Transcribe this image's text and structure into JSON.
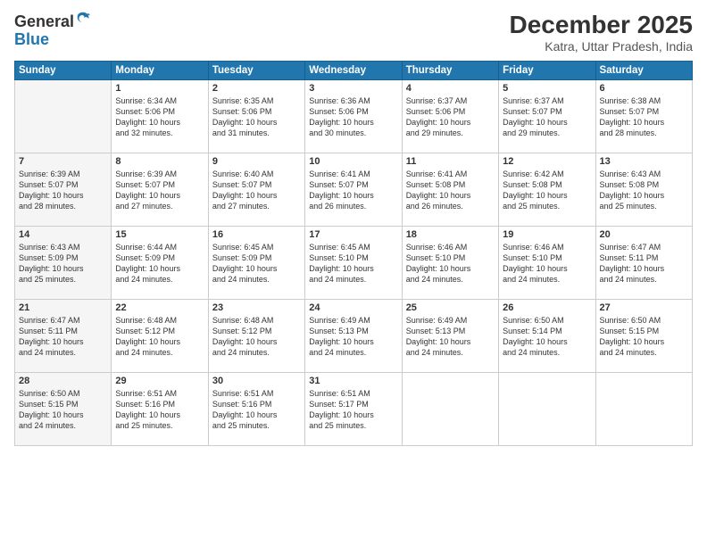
{
  "header": {
    "logo_general": "General",
    "logo_blue": "Blue",
    "month_title": "December 2025",
    "subtitle": "Katra, Uttar Pradesh, India"
  },
  "calendar": {
    "headers": [
      "Sunday",
      "Monday",
      "Tuesday",
      "Wednesday",
      "Thursday",
      "Friday",
      "Saturday"
    ],
    "weeks": [
      [
        {
          "day": "",
          "info": ""
        },
        {
          "day": "1",
          "info": "Sunrise: 6:34 AM\nSunset: 5:06 PM\nDaylight: 10 hours\nand 32 minutes."
        },
        {
          "day": "2",
          "info": "Sunrise: 6:35 AM\nSunset: 5:06 PM\nDaylight: 10 hours\nand 31 minutes."
        },
        {
          "day": "3",
          "info": "Sunrise: 6:36 AM\nSunset: 5:06 PM\nDaylight: 10 hours\nand 30 minutes."
        },
        {
          "day": "4",
          "info": "Sunrise: 6:37 AM\nSunset: 5:06 PM\nDaylight: 10 hours\nand 29 minutes."
        },
        {
          "day": "5",
          "info": "Sunrise: 6:37 AM\nSunset: 5:07 PM\nDaylight: 10 hours\nand 29 minutes."
        },
        {
          "day": "6",
          "info": "Sunrise: 6:38 AM\nSunset: 5:07 PM\nDaylight: 10 hours\nand 28 minutes."
        }
      ],
      [
        {
          "day": "7",
          "info": "Sunrise: 6:39 AM\nSunset: 5:07 PM\nDaylight: 10 hours\nand 28 minutes."
        },
        {
          "day": "8",
          "info": "Sunrise: 6:39 AM\nSunset: 5:07 PM\nDaylight: 10 hours\nand 27 minutes."
        },
        {
          "day": "9",
          "info": "Sunrise: 6:40 AM\nSunset: 5:07 PM\nDaylight: 10 hours\nand 27 minutes."
        },
        {
          "day": "10",
          "info": "Sunrise: 6:41 AM\nSunset: 5:07 PM\nDaylight: 10 hours\nand 26 minutes."
        },
        {
          "day": "11",
          "info": "Sunrise: 6:41 AM\nSunset: 5:08 PM\nDaylight: 10 hours\nand 26 minutes."
        },
        {
          "day": "12",
          "info": "Sunrise: 6:42 AM\nSunset: 5:08 PM\nDaylight: 10 hours\nand 25 minutes."
        },
        {
          "day": "13",
          "info": "Sunrise: 6:43 AM\nSunset: 5:08 PM\nDaylight: 10 hours\nand 25 minutes."
        }
      ],
      [
        {
          "day": "14",
          "info": "Sunrise: 6:43 AM\nSunset: 5:09 PM\nDaylight: 10 hours\nand 25 minutes."
        },
        {
          "day": "15",
          "info": "Sunrise: 6:44 AM\nSunset: 5:09 PM\nDaylight: 10 hours\nand 24 minutes."
        },
        {
          "day": "16",
          "info": "Sunrise: 6:45 AM\nSunset: 5:09 PM\nDaylight: 10 hours\nand 24 minutes."
        },
        {
          "day": "17",
          "info": "Sunrise: 6:45 AM\nSunset: 5:10 PM\nDaylight: 10 hours\nand 24 minutes."
        },
        {
          "day": "18",
          "info": "Sunrise: 6:46 AM\nSunset: 5:10 PM\nDaylight: 10 hours\nand 24 minutes."
        },
        {
          "day": "19",
          "info": "Sunrise: 6:46 AM\nSunset: 5:10 PM\nDaylight: 10 hours\nand 24 minutes."
        },
        {
          "day": "20",
          "info": "Sunrise: 6:47 AM\nSunset: 5:11 PM\nDaylight: 10 hours\nand 24 minutes."
        }
      ],
      [
        {
          "day": "21",
          "info": "Sunrise: 6:47 AM\nSunset: 5:11 PM\nDaylight: 10 hours\nand 24 minutes."
        },
        {
          "day": "22",
          "info": "Sunrise: 6:48 AM\nSunset: 5:12 PM\nDaylight: 10 hours\nand 24 minutes."
        },
        {
          "day": "23",
          "info": "Sunrise: 6:48 AM\nSunset: 5:12 PM\nDaylight: 10 hours\nand 24 minutes."
        },
        {
          "day": "24",
          "info": "Sunrise: 6:49 AM\nSunset: 5:13 PM\nDaylight: 10 hours\nand 24 minutes."
        },
        {
          "day": "25",
          "info": "Sunrise: 6:49 AM\nSunset: 5:13 PM\nDaylight: 10 hours\nand 24 minutes."
        },
        {
          "day": "26",
          "info": "Sunrise: 6:50 AM\nSunset: 5:14 PM\nDaylight: 10 hours\nand 24 minutes."
        },
        {
          "day": "27",
          "info": "Sunrise: 6:50 AM\nSunset: 5:15 PM\nDaylight: 10 hours\nand 24 minutes."
        }
      ],
      [
        {
          "day": "28",
          "info": "Sunrise: 6:50 AM\nSunset: 5:15 PM\nDaylight: 10 hours\nand 24 minutes."
        },
        {
          "day": "29",
          "info": "Sunrise: 6:51 AM\nSunset: 5:16 PM\nDaylight: 10 hours\nand 25 minutes."
        },
        {
          "day": "30",
          "info": "Sunrise: 6:51 AM\nSunset: 5:16 PM\nDaylight: 10 hours\nand 25 minutes."
        },
        {
          "day": "31",
          "info": "Sunrise: 6:51 AM\nSunset: 5:17 PM\nDaylight: 10 hours\nand 25 minutes."
        },
        {
          "day": "",
          "info": ""
        },
        {
          "day": "",
          "info": ""
        },
        {
          "day": "",
          "info": ""
        }
      ]
    ]
  }
}
